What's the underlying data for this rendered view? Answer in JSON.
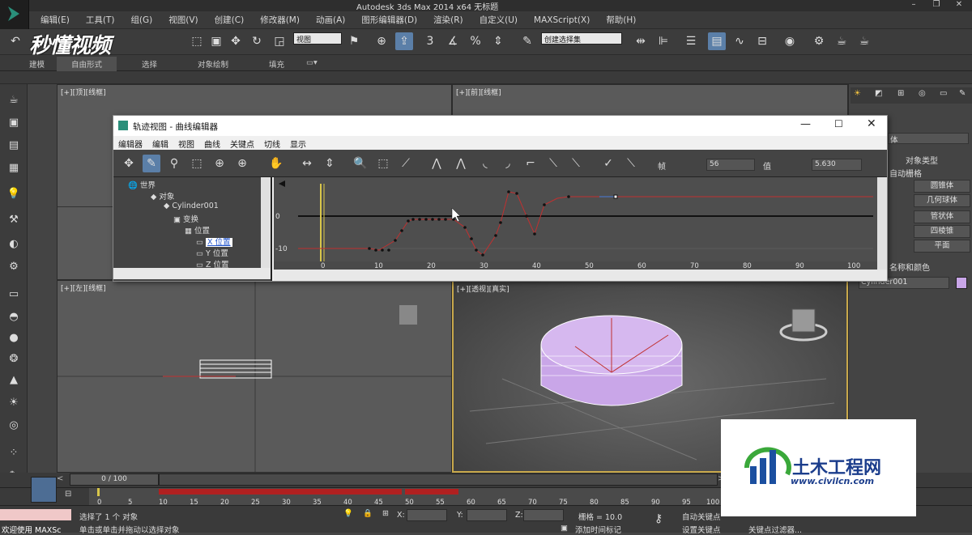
{
  "window": {
    "title": "Autodesk 3ds Max  2014 x64    无标题"
  },
  "menu": [
    "编辑(E)",
    "工具(T)",
    "组(G)",
    "视图(V)",
    "创建(C)",
    "修改器(M)",
    "动画(A)",
    "图形编辑器(D)",
    "渲染(R)",
    "自定义(U)",
    "MAXScript(X)",
    "帮助(H)"
  ],
  "toolbar": {
    "view_select": "视图",
    "selection_set": "创建选择集",
    "snap_label": "3",
    "angle_label": "%"
  },
  "ribbon": {
    "tabs": [
      "建模",
      "自由形式",
      "选择",
      "对象绘制",
      "填充"
    ]
  },
  "viewports": {
    "top": "[+][顶][线框]",
    "front": "[+][前][线框]",
    "left": "[+][左][线框]",
    "persp": "[+][透视][真实]"
  },
  "curve_editor": {
    "title": "轨迹视图 - 曲线编辑器",
    "menu": [
      "编辑器",
      "编辑",
      "视图",
      "曲线",
      "关键点",
      "切线",
      "显示"
    ],
    "frame_label": "帧",
    "frame_value": "56",
    "value_label": "值",
    "value_value": "5.630",
    "tree": {
      "world": "世界",
      "objects": "对象",
      "cylinder": "Cylinder001",
      "transform": "变换",
      "position": "位置",
      "x_pos": "X 位置",
      "y_pos": "Y 位置",
      "z_pos": "Z 位置"
    },
    "y_labels": [
      "0",
      "-10"
    ],
    "x_labels": [
      "0",
      "10",
      "20",
      "30",
      "40",
      "50",
      "60",
      "70",
      "80",
      "90",
      "100"
    ]
  },
  "command_panel": {
    "object_type": "对象类型",
    "auto_grid": "自动栅格",
    "buttons": [
      "圆锥体",
      "几何球体",
      "管状体",
      "四棱锥",
      "平面"
    ],
    "name_color": "名称和颜色",
    "object_name": "Cylinder001",
    "dropdown": "体",
    "object_color": "#c9a6e8"
  },
  "timeline": {
    "frame_slider": "0 / 100",
    "ticks": [
      "0",
      "5",
      "10",
      "15",
      "20",
      "25",
      "30",
      "35",
      "40",
      "45",
      "50",
      "55",
      "60",
      "65",
      "70",
      "75",
      "80",
      "85",
      "90",
      "95",
      "100"
    ]
  },
  "status": {
    "selected": "选择了 1 个 对象",
    "hint": "单击或单击并拖动以选择对象",
    "welcome": "欢迎使用 MAXSc",
    "x_label": "X:",
    "y_label": "Y:",
    "z_label": "Z:",
    "grid": "栅格 = 10.0",
    "auto_key": "自动关键点",
    "set_key": "设置关键点",
    "key_filter": "关键点过滤器...",
    "add_time_tag": "添加时间标记"
  },
  "watermarks": {
    "top_left": "秒懂视频",
    "bottom_right_cn": "土木工程网",
    "bottom_right_url": "www.civilcn.com"
  },
  "colors": {
    "accent_blue": "#5b7fa8",
    "curve_red": "#c03030",
    "key_yellow": "#d8c64a",
    "selection_frame": "#c8a84b",
    "wm_green": "#3aa83a",
    "wm_blue": "#1b4fa0"
  }
}
